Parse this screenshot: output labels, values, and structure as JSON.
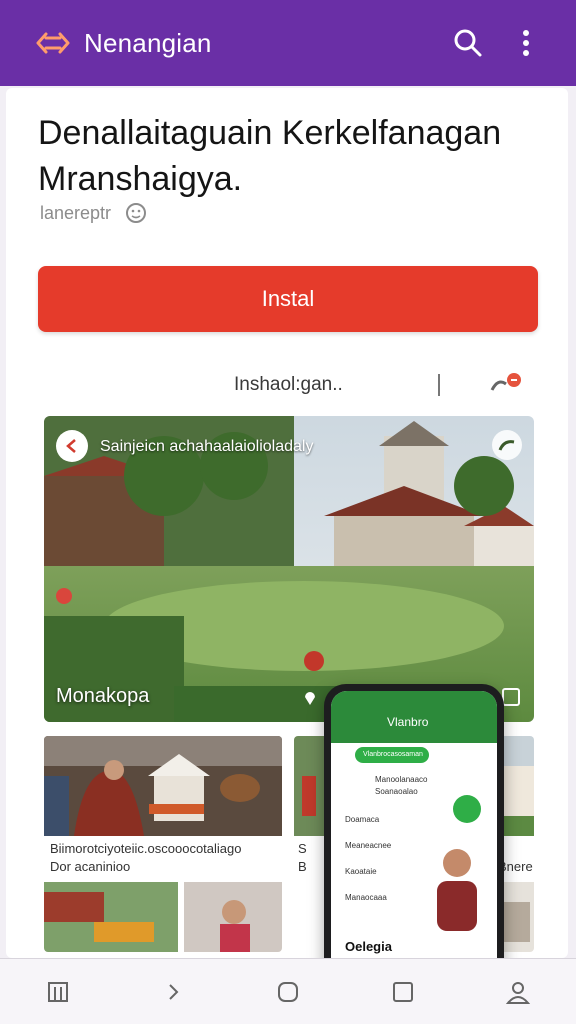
{
  "appbar": {
    "title": "Nenangian",
    "icons": [
      "brand-icon",
      "search-icon",
      "more-vert-icon"
    ],
    "color": "#6a2fa6"
  },
  "listing": {
    "headline": "Denallaitaguain Kerkelfanagan Mranshaigya.",
    "meta": "lanereptr",
    "install_label": "Instal",
    "install_color": "#e53b2b",
    "subrow_text": "Inshaol:gan.."
  },
  "hero": {
    "caption": "Sainjeicn achahaalaiolioladaly",
    "label": "Monakopa"
  },
  "tiles": [
    {
      "text1": "Biimorotciyoteiic.oscooocotaliago",
      "text2": "Dor acaninioo"
    },
    {
      "text1": "S",
      "text2": "B"
    },
    {
      "text1": "l   Bnere",
      "text2": ""
    }
  ],
  "phone": {
    "title": "Vlanbro",
    "chip": "Vlanbrocasosaman",
    "rows": [
      "Manoolanaaco",
      "Soanaoalao",
      "Doamaca",
      "Meaneacnee",
      "Kaoataie",
      "Manaocaaa"
    ],
    "brand": "Oelegia"
  },
  "bottomnav": {
    "icons": [
      "library-icon",
      "chevron-right-icon",
      "home-circle-icon",
      "square-icon",
      "profile-icon"
    ]
  }
}
